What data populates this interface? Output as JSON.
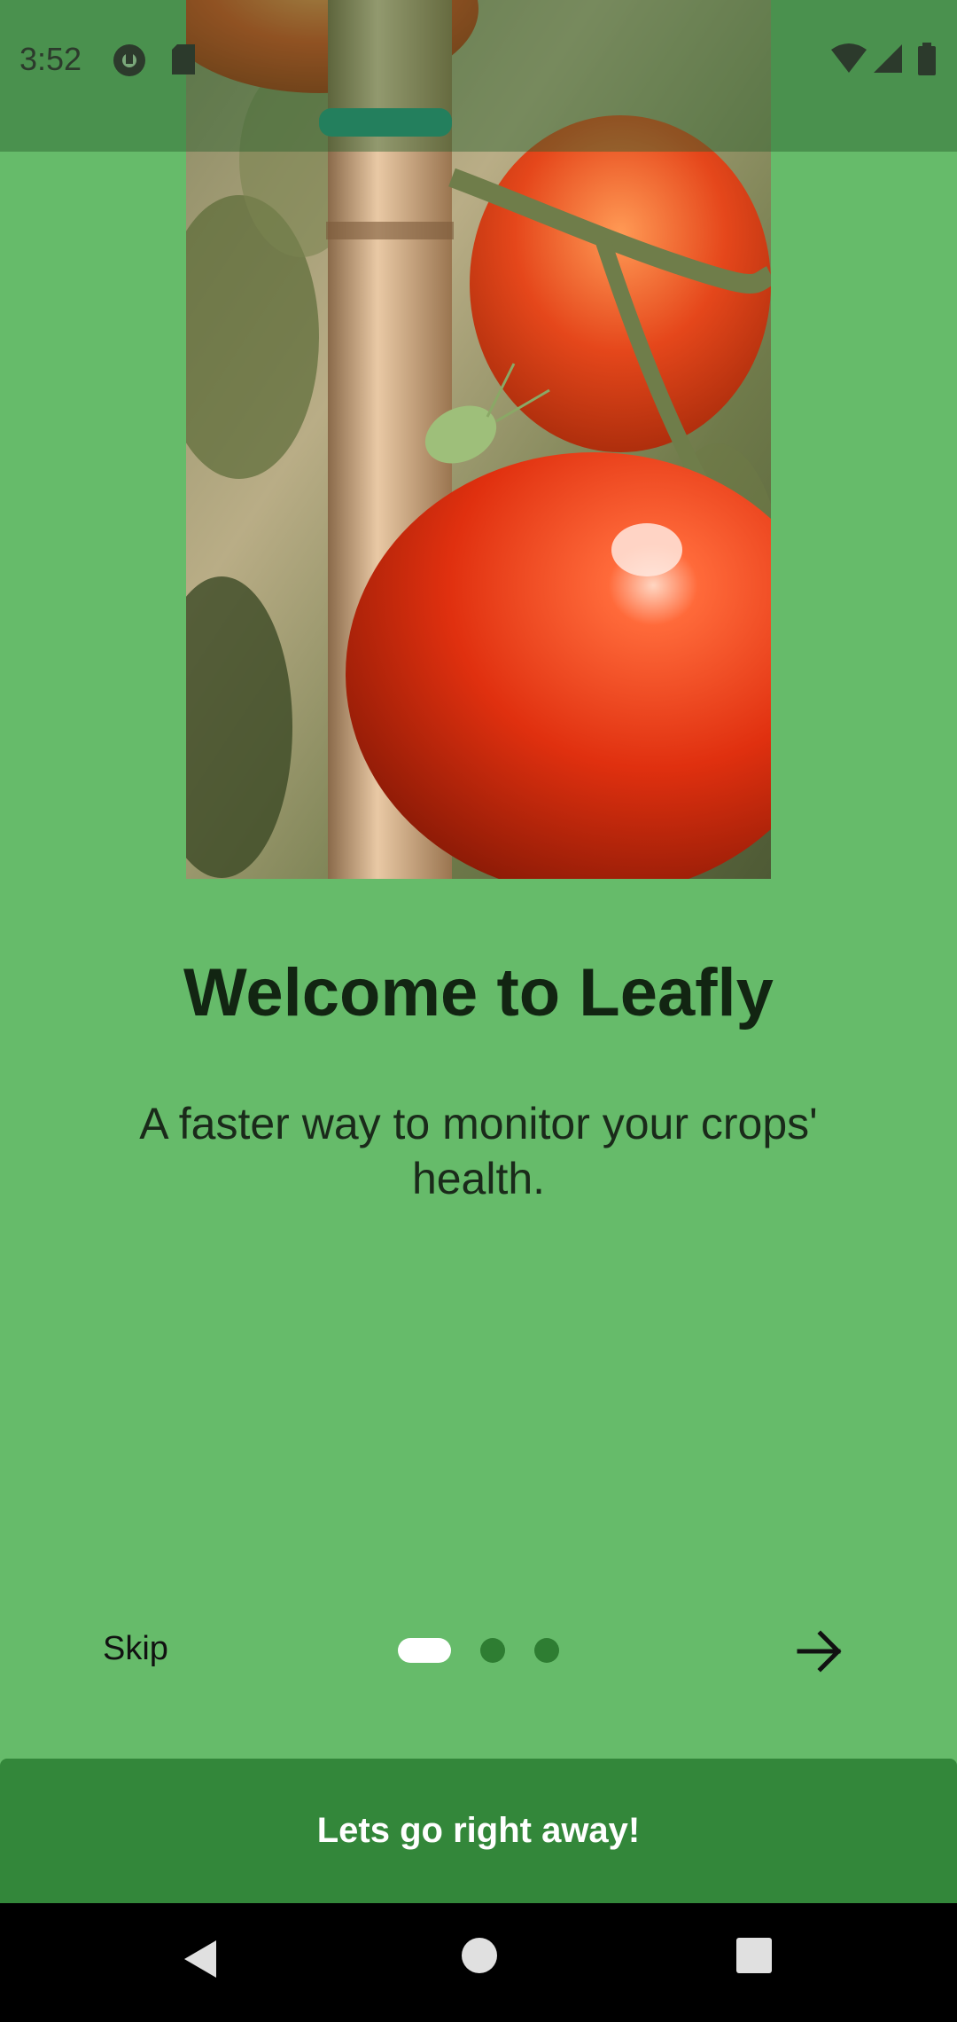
{
  "status_bar": {
    "time": "3:52",
    "left_icons": [
      "privacy-indicator-icon",
      "sd-card-icon"
    ],
    "right_icons": [
      "wifi-icon",
      "cell-signal-icon",
      "battery-icon"
    ]
  },
  "onboarding": {
    "title": "Welcome to Leafly",
    "subtitle": "A faster way to monitor your crops' health.",
    "skip_label": "Skip",
    "page_count": 3,
    "current_page": 1,
    "next_icon": "arrow-right-icon",
    "cta_label": "Lets go right away!"
  },
  "nav_bar": {
    "icons": [
      "back-icon",
      "home-icon",
      "recents-icon"
    ]
  },
  "colors": {
    "background": "#66bb6a",
    "cta": "#33873a",
    "indicator_active": "#ffffff",
    "indicator_inactive": "#2e7d32",
    "title_text": "#122512"
  }
}
